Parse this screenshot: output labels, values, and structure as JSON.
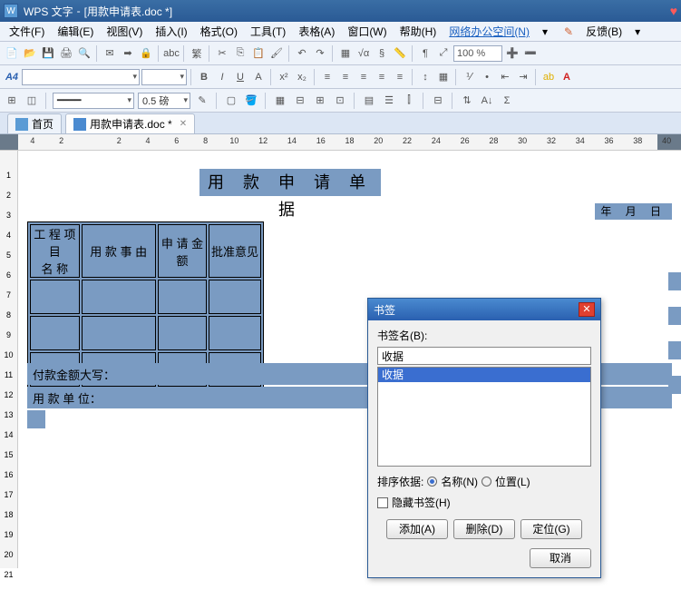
{
  "titlebar": {
    "app": "WPS 文字",
    "doc": "[用款申请表.doc *]"
  },
  "menus": {
    "file": "文件(F)",
    "edit": "编辑(E)",
    "view": "视图(V)",
    "insert": "插入(I)",
    "format": "格式(O)",
    "tools": "工具(T)",
    "table": "表格(A)",
    "window": "窗口(W)",
    "help": "帮助(H)",
    "remote": "网络办公空间(N)",
    "feedback": "反馈(B)"
  },
  "toolbar": {
    "zoom": "100 %",
    "trad": "繁",
    "spell": "abc"
  },
  "format": {
    "styleA": "A4",
    "lineweight": "0.5 磅"
  },
  "tabs": {
    "home": "首页",
    "doc": "用款申请表.doc *"
  },
  "ruler_h": [
    "4",
    "2",
    "",
    "2",
    "4",
    "6",
    "8",
    "10",
    "12",
    "14",
    "16",
    "18",
    "20",
    "22",
    "24",
    "26",
    "28",
    "30",
    "32",
    "34",
    "36",
    "38",
    "40"
  ],
  "ruler_v": [
    "",
    "1",
    "2",
    "3",
    "4",
    "5",
    "6",
    "7",
    "8",
    "9",
    "10",
    "11",
    "12",
    "13",
    "14",
    "15",
    "16",
    "17",
    "18",
    "19",
    "20",
    "21"
  ],
  "doc": {
    "title": "用 款 申 请 单 据",
    "date": "年    月    日",
    "headers": {
      "c1": "工 程 项 目\n名      称",
      "c2": "用 款 事 由",
      "c3": "申 请 金 额",
      "c4": "批准意见"
    },
    "row1": "付款金额大写：",
    "row2": "用 款 单 位："
  },
  "dialog": {
    "title": "书签",
    "name_label": "书签名(B):",
    "name_value": "收据",
    "list": [
      "收据"
    ],
    "sort_label": "排序依据:",
    "sort_name": "名称(N)",
    "sort_loc": "位置(L)",
    "hide": "隐藏书签(H)",
    "btn_add": "添加(A)",
    "btn_del": "删除(D)",
    "btn_goto": "定位(G)",
    "btn_cancel": "取消"
  }
}
